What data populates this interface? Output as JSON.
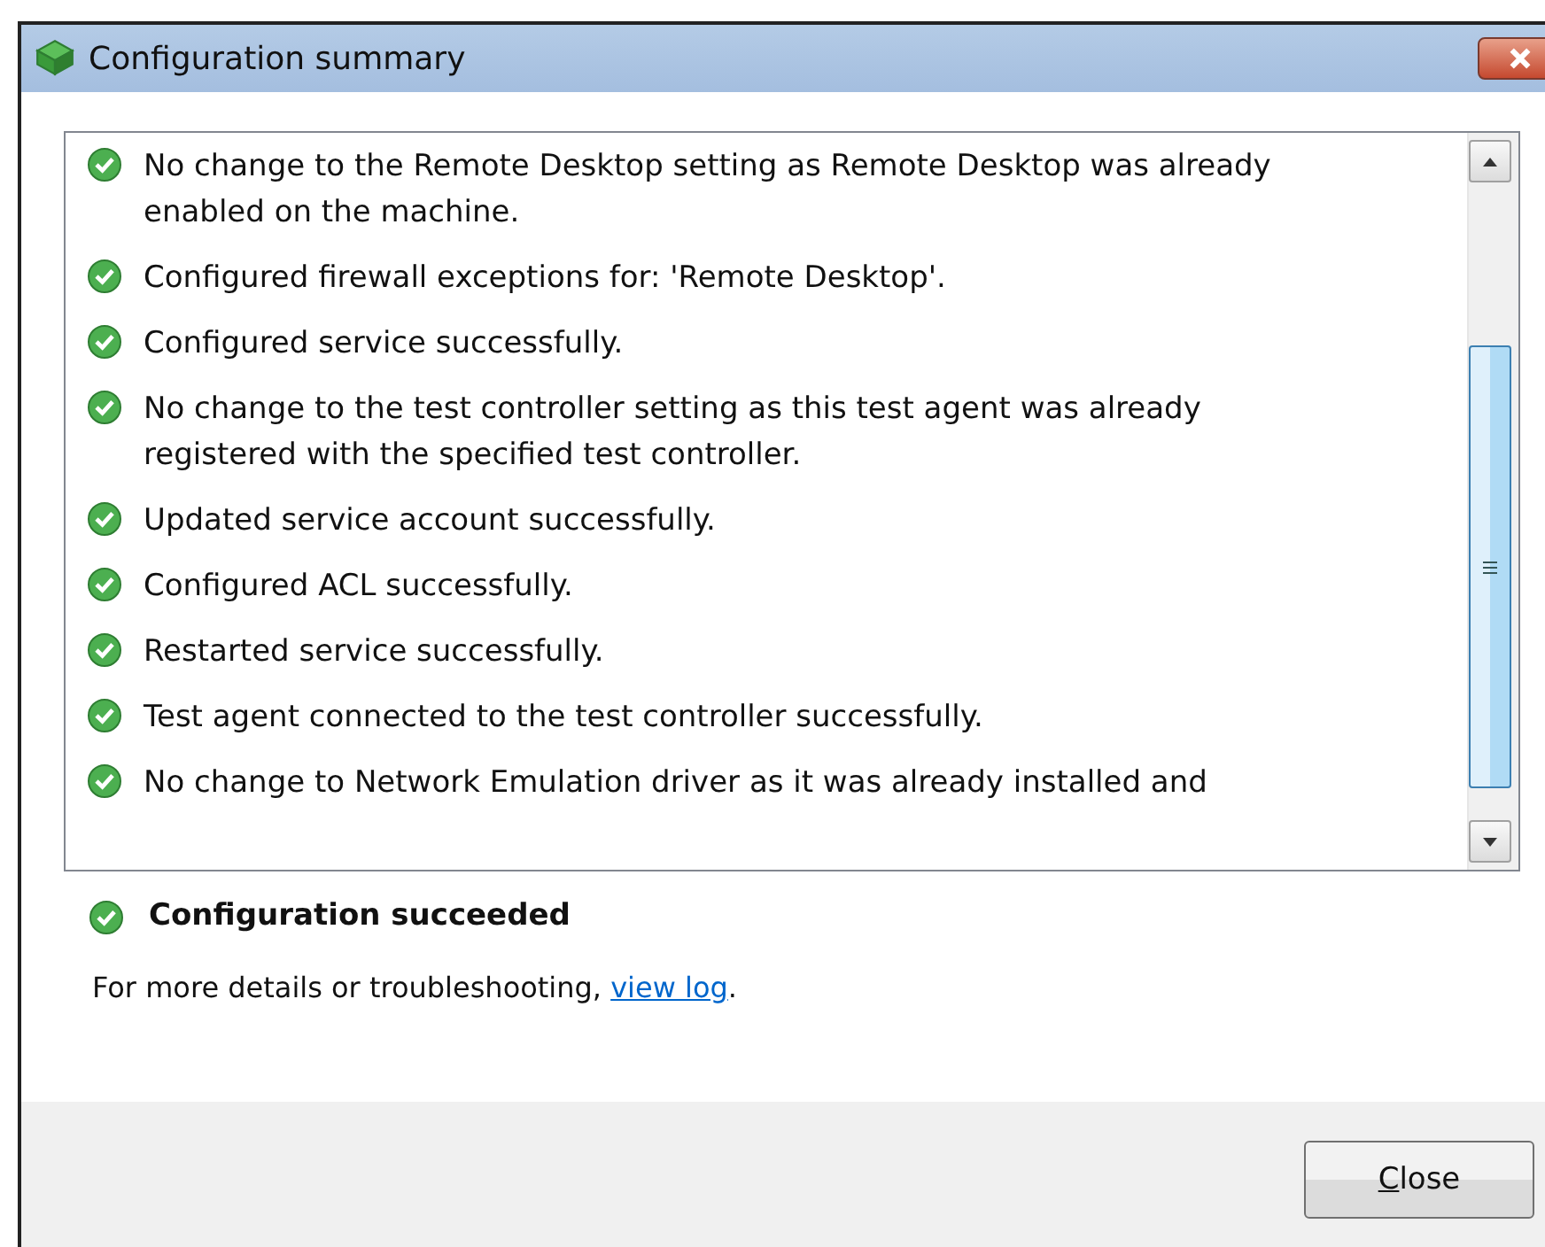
{
  "window": {
    "title": "Configuration summary"
  },
  "results": [
    {
      "text": "No change to the Remote Desktop setting as Remote Desktop was already enabled on the machine.",
      "kind": "success"
    },
    {
      "text": "Configured firewall exceptions for: 'Remote Desktop'.",
      "kind": "success"
    },
    {
      "text": "Configured service successfully.",
      "kind": "success"
    },
    {
      "text": "No change to the test controller setting as this test agent was already registered with the specified test controller.",
      "kind": "success"
    },
    {
      "text": "Updated service account successfully.",
      "kind": "success"
    },
    {
      "text": "Configured ACL successfully.",
      "kind": "success"
    },
    {
      "text": "Restarted service successfully.",
      "kind": "success"
    },
    {
      "text": "Test agent connected to the test controller successfully.",
      "kind": "success"
    },
    {
      "text": "No change to Network Emulation driver as it was already installed and",
      "kind": "success"
    }
  ],
  "summary": {
    "text": "Configuration succeeded",
    "kind": "success"
  },
  "details": {
    "text": "For more details or troubleshooting, ",
    "link": "view log",
    "after": "."
  },
  "buttons": [
    "Close"
  ]
}
